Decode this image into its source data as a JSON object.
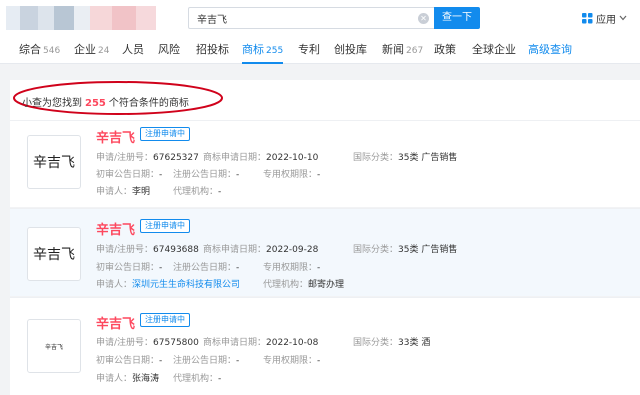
{
  "header": {
    "search_value": "辛吉飞",
    "search_button": "查一下",
    "app_menu_label": "应用",
    "blur_colors": [
      "#e6ecf3",
      "#c9d3df",
      "#dde4ec",
      "#b8c6d4",
      "#eaeef3",
      "#f6d7d9",
      "#f1c3c7",
      "#f6d9dc"
    ]
  },
  "nav": {
    "tabs": [
      {
        "label": "综合",
        "count": "546"
      },
      {
        "label": "企业",
        "count": "24"
      },
      {
        "label": "人员",
        "count": ""
      },
      {
        "label": "风险",
        "count": ""
      },
      {
        "label": "招投标",
        "count": ""
      },
      {
        "label": "商标",
        "count": "255"
      },
      {
        "label": "专利",
        "count": ""
      },
      {
        "label": "创投库",
        "count": ""
      },
      {
        "label": "新闻",
        "count": "267"
      },
      {
        "label": "政策",
        "count": ""
      },
      {
        "label": "全球企业",
        "count": ""
      },
      {
        "label": "高级查询",
        "count": ""
      }
    ],
    "active_tab": "商标"
  },
  "results": {
    "prefix": "小查为您找到",
    "count": "255",
    "suffix": "个符合条件的商标"
  },
  "labels": {
    "reg_no": "申请/注册号：",
    "apply_date": "商标申请日期：",
    "intl_class": "国际分类：",
    "first_notice": "初审公告日期：",
    "reg_notice": "注册公告日期：",
    "exclusive_period": "专用权期限：",
    "applicant": "申请人：",
    "agency": "代理机构："
  },
  "cards": [
    {
      "thumb_text": "辛吉飞",
      "name": "辛吉飞",
      "status": "注册申请中",
      "reg_no": "67625327",
      "apply_date": "2022-10-10",
      "intl_class": "35类 广告销售",
      "first_notice": "-",
      "reg_notice": "-",
      "exclusive_period": "-",
      "applicant": "李明",
      "agency": "-"
    },
    {
      "thumb_text": "辛吉飞",
      "name": "辛吉飞",
      "status": "注册申请中",
      "reg_no": "67493688",
      "apply_date": "2022-09-28",
      "intl_class": "35类 广告销售",
      "first_notice": "-",
      "reg_notice": "-",
      "exclusive_period": "-",
      "applicant": "深圳元生生命科技有限公司",
      "agency": "邮寄办理"
    },
    {
      "thumb_text": "辛吉飞",
      "name": "辛吉飞",
      "status": "注册申请中",
      "reg_no": "67575800",
      "apply_date": "2022-10-08",
      "intl_class": "33类 酒",
      "first_notice": "-",
      "reg_notice": "-",
      "exclusive_period": "-",
      "applicant": "张海涛",
      "agency": "-"
    }
  ]
}
